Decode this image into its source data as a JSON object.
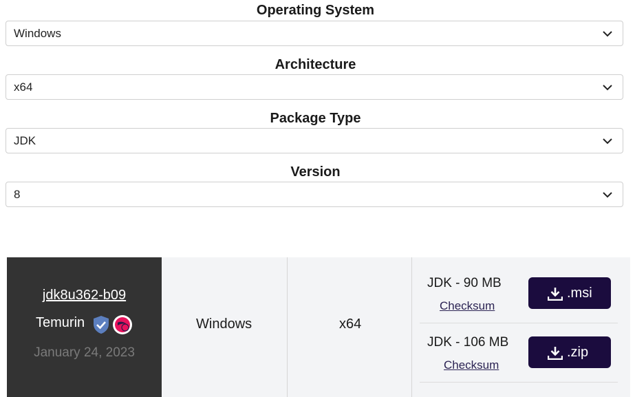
{
  "filters": [
    {
      "label": "Operating System",
      "value": "Windows"
    },
    {
      "label": "Architecture",
      "value": "x64"
    },
    {
      "label": "Package Type",
      "value": "JDK"
    },
    {
      "label": "Version",
      "value": "8"
    }
  ],
  "release": {
    "name": "jdk8u362-b09",
    "vendor": "Temurin",
    "date": "January 24, 2023",
    "os": "Windows",
    "arch": "x64",
    "packages": [
      {
        "size_label": "JDK - 90 MB",
        "checksum_label": "Checksum",
        "download_label": ".msi"
      },
      {
        "size_label": "JDK - 106 MB",
        "checksum_label": "Checksum",
        "download_label": ".zip"
      }
    ]
  },
  "icons": {
    "select_chevron": "chevron-down-icon",
    "verified": "shield-check-icon",
    "vendor_logo": "eclipse-temurin-logo",
    "download": "download-icon"
  },
  "colors": {
    "dark_column": "#333333",
    "button_bg": "#1b0c3e",
    "checksum_link": "#2b2353",
    "shield": "#5c7fbf",
    "logo_pink": "#e8125c"
  }
}
